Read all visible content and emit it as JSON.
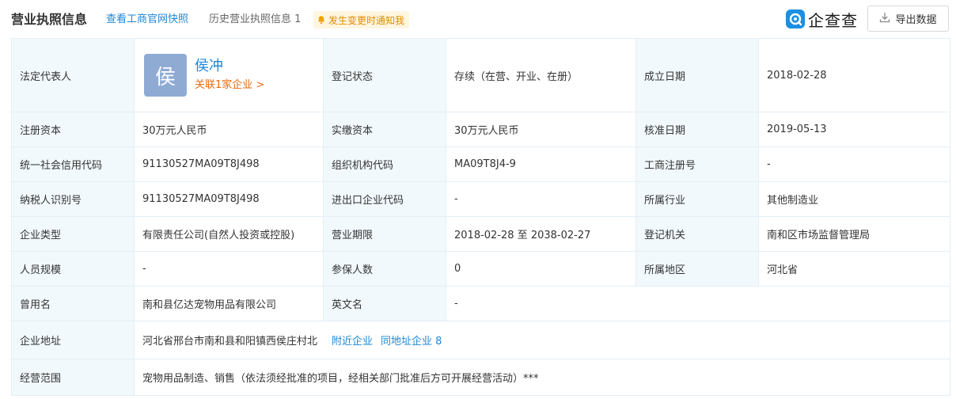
{
  "header": {
    "title": "营业执照信息",
    "link_snapshot": "查看工商官网快照",
    "history_label": "历史营业执照信息",
    "history_count": "1",
    "notify_label": "发生变更时通知我",
    "logo_text": "企查查",
    "export_label": "导出数据",
    "colors": {
      "link": "#1f87d6",
      "notify_bg": "#fff6e0",
      "notify_text": "#e38b00",
      "label_bg": "#f2f9fc",
      "brand": "#1a8fe3"
    },
    "icons": {
      "notify": "bell-icon",
      "logo": "qichacha-logo-icon",
      "export": "download-icon"
    }
  },
  "rows": {
    "legal_rep": {
      "label": "法定代表人",
      "avatar_char": "侯",
      "name": "侯冲",
      "related": "关联1家企业 >"
    },
    "reg_status": {
      "label": "登记状态",
      "value": "存续（在营、开业、在册）"
    },
    "established": {
      "label": "成立日期",
      "value": "2018-02-28"
    },
    "reg_capital": {
      "label": "注册资本",
      "value": "30万元人民币"
    },
    "paid_capital": {
      "label": "实缴资本",
      "value": "30万元人民币"
    },
    "approval_date": {
      "label": "核准日期",
      "value": "2019-05-13"
    },
    "credit_code": {
      "label": "统一社会信用代码",
      "value": "91130527MA09T8J498"
    },
    "org_code": {
      "label": "组织机构代码",
      "value": "MA09T8J4-9"
    },
    "reg_number": {
      "label": "工商注册号",
      "value": "-"
    },
    "taxpayer_id": {
      "label": "纳税人识别号",
      "value": "91130527MA09T8J498"
    },
    "import_export": {
      "label": "进出口企业代码",
      "value": "-"
    },
    "industry": {
      "label": "所属行业",
      "value": "其他制造业"
    },
    "company_type": {
      "label": "企业类型",
      "value": "有限责任公司(自然人投资或控股)"
    },
    "business_term": {
      "label": "营业期限",
      "value": "2018-02-28 至 2038-02-27"
    },
    "reg_authority": {
      "label": "登记机关",
      "value": "南和区市场监督管理局"
    },
    "staff_size": {
      "label": "人员规模",
      "value": "-"
    },
    "insured": {
      "label": "参保人数",
      "value": "0"
    },
    "region": {
      "label": "所属地区",
      "value": "河北省"
    },
    "former_name": {
      "label": "曾用名",
      "value": "南和县亿达宠物用品有限公司"
    },
    "english_name": {
      "label": "英文名",
      "value": "-"
    },
    "address": {
      "label": "企业地址",
      "value": "河北省邢台市南和县和阳镇西侯庄村北",
      "nearby": "附近企业",
      "same_addr": "同地址企业 8"
    },
    "scope": {
      "label": "经营范围",
      "value": "宠物用品制造、销售（依法须经批准的项目，经相关部门批准后方可开展经营活动）***"
    }
  }
}
